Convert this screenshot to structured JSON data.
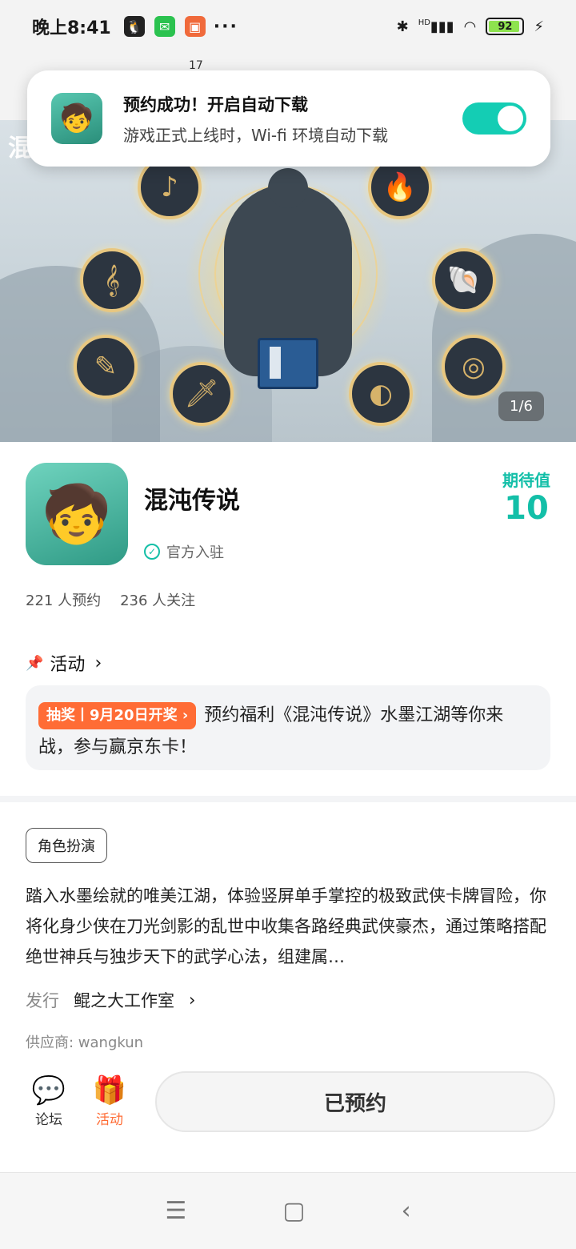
{
  "status_bar": {
    "time": "晚上8:41",
    "apps": [
      "qq-icon",
      "wechat-icon",
      "app-icon"
    ],
    "more": "···",
    "network": "HD",
    "battery": "92"
  },
  "header": {
    "back": "‹",
    "count": "17"
  },
  "notification": {
    "title": "预约成功！开启自动下载",
    "subtitle": "游戏正式上线时，Wi-fi 环境自动下载",
    "toggle_on": true
  },
  "banner": {
    "title_fragment": "混",
    "pager": "1/6"
  },
  "game": {
    "name": "混沌传说",
    "verified_label": "官方入驻",
    "expect_label": "期待值",
    "expect_value": "10",
    "reservations": "221 人预约",
    "follows": "236 人关注"
  },
  "activity": {
    "heading": "活动",
    "tag": "抽奖丨9月20日开奖 ›",
    "text": "预约福利《混沌传说》水墨江湖等你来战，参与赢京东卡！"
  },
  "details": {
    "genre": "角色扮演",
    "description": "踏入水墨绘就的唯美江湖，体验竖屏单手掌控的极致武侠卡牌冒险，你将化身少侠在刀光剑影的乱世中收集各路经典武侠豪杰，通过策略搭配绝世神兵与独步天下的武学心法，组建属…",
    "publisher_label": "发行",
    "publisher_name": "鲲之大工作室",
    "supplier": "供应商: wangkun"
  },
  "actions": {
    "forum_label": "论坛",
    "event_label": "活动",
    "reserve_label": "已预约"
  },
  "colors": {
    "accent": "#13bfa8",
    "orange": "#ff6c35"
  }
}
